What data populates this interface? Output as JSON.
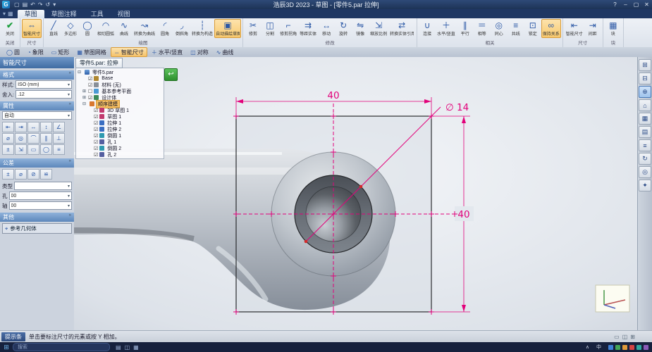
{
  "titlebar": {
    "title": "浩辰3D 2023 - 草图 - [零件5.par 拉伸]",
    "qat": [
      "▢",
      "▤",
      "↶",
      "↷",
      "↺",
      "▾"
    ],
    "controls": [
      "?",
      "–",
      "▢",
      "✕"
    ]
  },
  "tabrow": {
    "icons": [
      "▾",
      "▦"
    ],
    "tabs": [
      {
        "label": "草图",
        "active": true
      },
      {
        "label": "草图注释"
      },
      {
        "label": "工具"
      },
      {
        "label": "视图"
      }
    ]
  },
  "ribbon": {
    "groups": [
      {
        "label": "关闭",
        "buttons": [
          {
            "icon": "✔",
            "label": "关闭",
            "variant": "green"
          }
        ]
      },
      {
        "label": "尺寸",
        "buttons": [
          {
            "icon": "⇔",
            "label": "智能尺寸",
            "active": true
          }
        ]
      },
      {
        "label": "绘图",
        "buttons": [
          {
            "icon": "╱",
            "label": "直线"
          },
          {
            "icon": "◇",
            "label": "多边形"
          },
          {
            "icon": "◯",
            "label": "圆"
          },
          {
            "icon": "◠",
            "label": "相切圆弧"
          },
          {
            "icon": "∿",
            "label": "曲线"
          },
          {
            "icon": "↝",
            "label": "转换为曲线"
          },
          {
            "icon": "◜",
            "label": "圆角"
          },
          {
            "icon": "◞",
            "label": "倒斜角"
          },
          {
            "icon": "┆",
            "label": "转换为构造"
          },
          {
            "icon": "▣",
            "label": "自动描绘草图",
            "active": true
          }
        ]
      },
      {
        "label": "修改",
        "buttons": [
          {
            "icon": "✂",
            "label": "修剪"
          },
          {
            "icon": "◫",
            "label": "分割"
          },
          {
            "icon": "⌐",
            "label": "修剪拐角"
          },
          {
            "icon": "⇉",
            "label": "等距实体"
          },
          {
            "icon": "↔",
            "label": "移动"
          },
          {
            "icon": "↻",
            "label": "旋转"
          },
          {
            "icon": "⇋",
            "label": "镜像"
          },
          {
            "icon": "⇲",
            "label": "缩放比例"
          },
          {
            "icon": "⇄",
            "label": "转换实体引用"
          }
        ]
      },
      {
        "label": "相关",
        "buttons": [
          {
            "icon": "∪",
            "label": "连接"
          },
          {
            "icon": "＋",
            "label": "水平/竖直"
          },
          {
            "icon": "∥",
            "label": "平行"
          },
          {
            "icon": "＝",
            "label": "相等"
          },
          {
            "icon": "◎",
            "label": "同心"
          },
          {
            "icon": "≡",
            "label": "共线"
          },
          {
            "icon": "⊡",
            "label": "锁定"
          },
          {
            "icon": "∞",
            "label": "保持关系",
            "active": true
          }
        ]
      },
      {
        "label": "尺寸",
        "buttons": [
          {
            "icon": "⇤",
            "label": "智能尺寸"
          },
          {
            "icon": "⇥",
            "label": "间距"
          }
        ]
      },
      {
        "label": "块",
        "buttons": [
          {
            "icon": "▦",
            "label": "块"
          }
        ]
      }
    ]
  },
  "quickbar": {
    "items": [
      {
        "icon": "◯",
        "label": "圆"
      },
      {
        "icon": "◔",
        "label": "象限"
      },
      {
        "icon": "▭",
        "label": "矩形"
      },
      {
        "icon": "▦",
        "label": "草图网格"
      },
      {
        "icon": "⇔",
        "label": "智能尺寸",
        "active": true
      },
      {
        "icon": "＋",
        "label": "水平/竖直"
      },
      {
        "icon": "◫",
        "label": "对称"
      },
      {
        "icon": "∿",
        "label": "曲线"
      }
    ]
  },
  "panel": {
    "title": "智能尺寸",
    "format": {
      "title": "格式",
      "style_label": "样式:",
      "style_value": "ISO (mm)",
      "round_label": "舍入:",
      "round_value": ".12"
    },
    "props": {
      "title": "属性",
      "mode_value": "自动",
      "tools": [
        "⇤",
        "⇥",
        "↔",
        "↕",
        "∠",
        "⌀",
        "◎",
        "⌒",
        "∥",
        "⊥",
        "±",
        "⇲",
        "▭",
        "◯",
        "≡"
      ]
    },
    "tol": {
      "title": "公差",
      "modes": [
        "±",
        "⌀",
        "⊘",
        "≌"
      ],
      "type_label": "类型",
      "rows": [
        {
          "label": "孔",
          "value": "00"
        },
        {
          "label": "轴",
          "value": "00"
        }
      ]
    },
    "other": {
      "title": "其他",
      "ref_label": "参考几何体"
    }
  },
  "tree": {
    "items": [
      {
        "exp": "⊟",
        "check": "",
        "icon": "ic-doc",
        "label": "零件5.par",
        "lvl": "lvl0"
      },
      {
        "exp": "",
        "check": "☑",
        "icon": "ic-base",
        "label": "Base",
        "lvl": "lvl1"
      },
      {
        "exp": "",
        "check": "☑",
        "icon": "ic-mat",
        "label": "材料 (无)",
        "lvl": "lvl1"
      },
      {
        "exp": "⊞",
        "check": "☐",
        "icon": "ic-plane",
        "label": "基本参考平面",
        "lvl": "lvl1"
      },
      {
        "exp": "⊞",
        "check": "☑",
        "icon": "ic-body",
        "label": "设计体",
        "lvl": "lvl1"
      },
      {
        "exp": "⊟",
        "check": "",
        "icon": "ic-seq",
        "label": "顺序建模",
        "lvl": "lvl1",
        "active": true
      },
      {
        "exp": "",
        "check": "☑",
        "icon": "ic-sketch",
        "label": "3D 草图 1",
        "lvl": "lvl2"
      },
      {
        "exp": "",
        "check": "☑",
        "icon": "ic-sketch",
        "label": "草图 1",
        "lvl": "lvl2"
      },
      {
        "exp": "",
        "check": "☑",
        "icon": "ic-feat",
        "label": "拉伸 1",
        "lvl": "lvl2"
      },
      {
        "exp": "",
        "check": "☑",
        "icon": "ic-feat",
        "label": "拉伸 2",
        "lvl": "lvl2"
      },
      {
        "exp": "",
        "check": "☑",
        "icon": "ic-round",
        "label": "倒圆 1",
        "lvl": "lvl2"
      },
      {
        "exp": "",
        "check": "☑",
        "icon": "ic-hole",
        "label": "孔 1",
        "lvl": "lvl2"
      },
      {
        "exp": "",
        "check": "☑",
        "icon": "ic-round",
        "label": "倒圆 2",
        "lvl": "lvl2"
      },
      {
        "exp": "",
        "check": "☑",
        "icon": "ic-hole",
        "label": "孔 2",
        "lvl": "lvl2"
      }
    ]
  },
  "canvas": {
    "doc_tab": "零件5.par: 拉伸",
    "finish_glyph": "↩",
    "dims": {
      "top": "40",
      "right": "40",
      "dia": "∅ 14"
    },
    "dim_color": "#e2007a"
  },
  "right_toolbar": {
    "buttons": [
      {
        "g": "⊞"
      },
      {
        "g": "⊟"
      },
      {
        "g": "⊕",
        "active": true
      },
      {
        "g": "⌂"
      },
      {
        "g": "▦"
      },
      {
        "g": "▤"
      },
      {
        "g": "≡"
      },
      {
        "g": "↻"
      },
      {
        "g": "◎"
      },
      {
        "g": "✦"
      }
    ]
  },
  "statusbar": {
    "chip": "提示条",
    "text": "单击要标注尺寸的元素或按 Y 相加。",
    "icons": [
      "▭",
      "◫",
      "⊞"
    ]
  },
  "taskbar": {
    "start": "⊞",
    "search": "搜索",
    "apps": [
      "▤",
      "◫",
      "▦"
    ],
    "tray": [
      {
        "g": "∧"
      },
      {
        "g": "中"
      },
      {
        "v": "tb"
      },
      {
        "v": "tg"
      },
      {
        "v": "to"
      },
      {
        "v": "tr"
      },
      {
        "v": "tt"
      },
      {
        "v": "tp"
      }
    ]
  }
}
